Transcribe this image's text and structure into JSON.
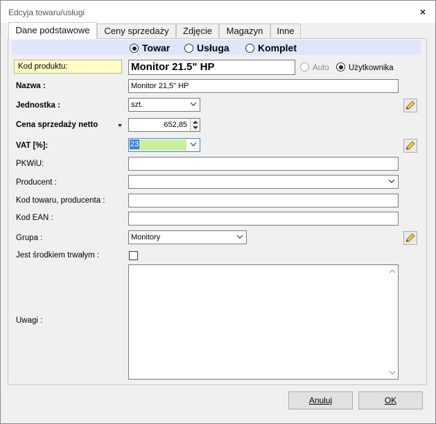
{
  "window": {
    "title": "Edcyja towaru/usługi",
    "close_glyph": "×"
  },
  "tabs": [
    {
      "label": "Dane podstawowe",
      "active": true
    },
    {
      "label": "Ceny sprzedaży",
      "active": false
    },
    {
      "label": "Zdjęcie",
      "active": false
    },
    {
      "label": "Magazyn",
      "active": false
    },
    {
      "label": "Inne",
      "active": false
    }
  ],
  "type_options": [
    {
      "label": "Towar",
      "selected": true
    },
    {
      "label": "Usługa",
      "selected": false
    },
    {
      "label": "Komplet",
      "selected": false
    }
  ],
  "form": {
    "kod_label": "Kod produktu:",
    "kod_value": "Monitor 21.5\" HP",
    "auto_label": "Auto",
    "user_label": "Użytkownika",
    "nazwa_label": "Nazwa :",
    "nazwa_value": "Monitor 21,5\" HP",
    "jednostka_label": "Jednostka :",
    "jednostka_value": "szt.",
    "cena_label": "Cena sprzedaży netto",
    "cena_value": "652,85",
    "vat_label": "VAT [%]:",
    "vat_value": "23",
    "pkwiu_label": "PKWiU:",
    "pkwiu_value": "",
    "producent_label": "Producent :",
    "producent_value": "",
    "kod_towaru_label": "Kod towaru, producenta :",
    "kod_towaru_value": "",
    "ean_label": "Kod EAN :",
    "ean_value": "",
    "grupa_label": "Grupa :",
    "grupa_value": "Monitory",
    "srodek_label": "Jest środkiem trwałym :",
    "srodek_checked": false,
    "uwagi_label": "Uwagi :",
    "uwagi_value": ""
  },
  "buttons": {
    "cancel_label": "Anuluj",
    "ok_label": "OK"
  },
  "icons": [
    "close-icon",
    "pencil-icon",
    "chevron-down-icon",
    "spin-up-icon",
    "spin-down-icon",
    "dropdown-triangle-icon",
    "scroll-up-icon",
    "scroll-down-icon"
  ],
  "colors": {
    "type_bar": "#dfe6fc",
    "code_box": "#ffffc6",
    "vat_field": "#c9ef9d",
    "selection": "#3f7fd8"
  }
}
